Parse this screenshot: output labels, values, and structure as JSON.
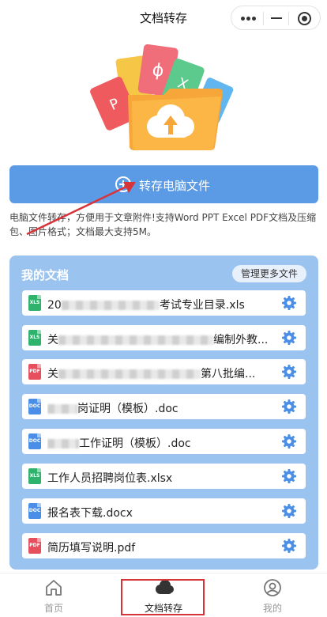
{
  "header": {
    "title": "文档转存"
  },
  "hero": {
    "icons": [
      "pdf-file-icon",
      "powerpoint-file-icon",
      "excel-file-icon",
      "folder-upload-icon"
    ]
  },
  "upload": {
    "label": "转存电脑文件",
    "description": "电脑文件转存，方便用于文章附件!支持Word PPT Excel PDF文档及压缩包、图片格式；文档最大支持5M。"
  },
  "docs": {
    "title": "我的文档",
    "manage_label": "管理更多文件",
    "items": [
      {
        "type": "xls",
        "type_label": "XLS",
        "prefix": "20",
        "suffix": "考试专业目录.xls"
      },
      {
        "type": "xls",
        "type_label": "XLS",
        "prefix": "关",
        "suffix": "编制外教..."
      },
      {
        "type": "pdf",
        "type_label": "PDF",
        "prefix": "关",
        "suffix": "第八批编..."
      },
      {
        "type": "doc",
        "type_label": "DOC",
        "prefix": "",
        "suffix": "岗证明（模板）.doc"
      },
      {
        "type": "doc",
        "type_label": "DOC",
        "prefix": "",
        "suffix": "工作证明（模板）.doc"
      },
      {
        "type": "xls",
        "type_label": "XLS",
        "prefix": "",
        "suffix": "工作人员招聘岗位表.xlsx"
      },
      {
        "type": "doc",
        "type_label": "DOC",
        "prefix": "",
        "suffix": "报名表下载.docx"
      },
      {
        "type": "pdf",
        "type_label": "PDF",
        "prefix": "",
        "suffix": "简历填写说明.pdf"
      }
    ]
  },
  "tabbar": {
    "tabs": [
      {
        "label": "首页",
        "icon": "home-icon"
      },
      {
        "label": "文档转存",
        "icon": "cloud-icon",
        "active": true
      },
      {
        "label": "我的",
        "icon": "user-icon"
      }
    ]
  },
  "colors": {
    "primary": "#5b9be6",
    "panel": "#9bc3ef",
    "annotation": "#d9333a"
  }
}
